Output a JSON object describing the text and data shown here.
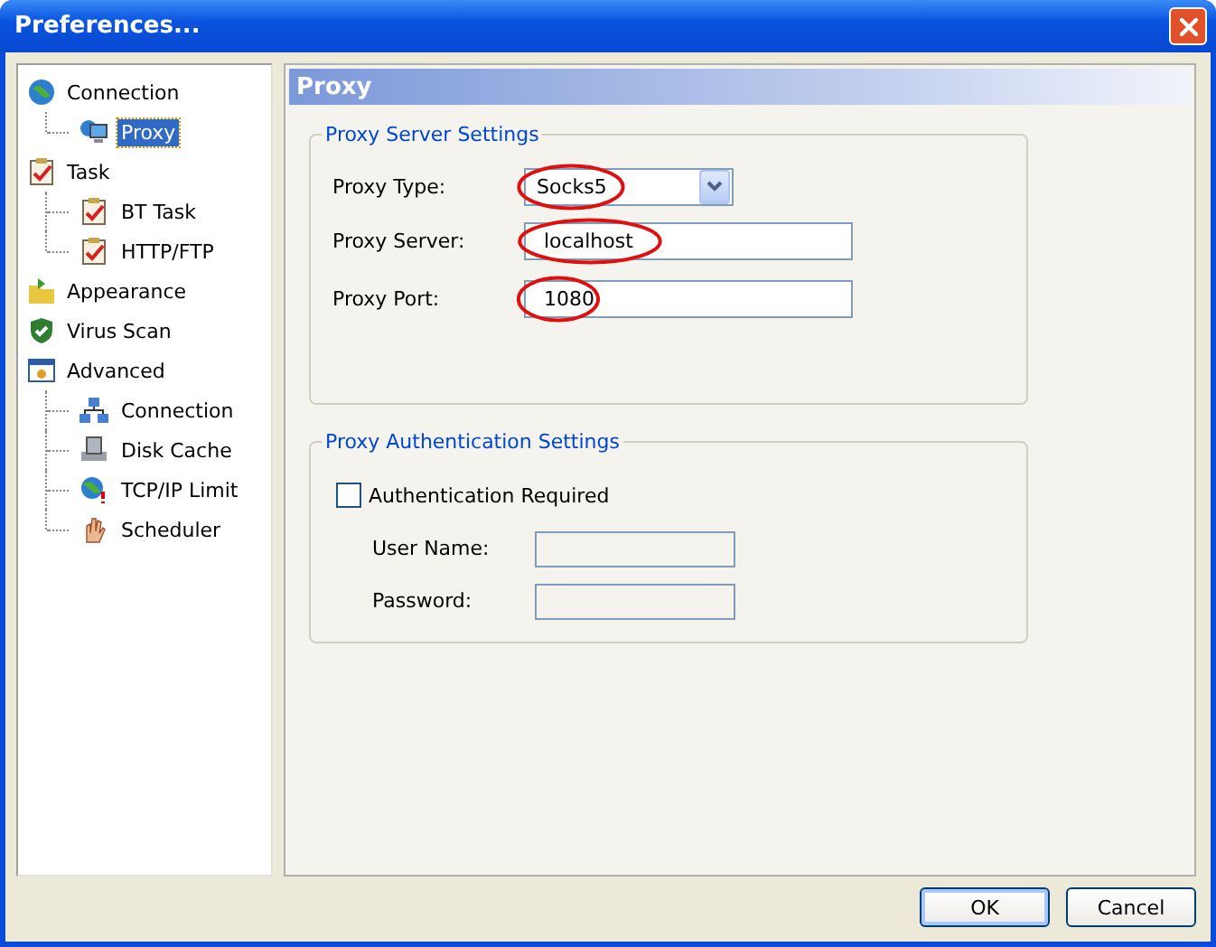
{
  "window": {
    "title": "Preferences..."
  },
  "tree": [
    {
      "label": "Connection",
      "selected": false,
      "children": [
        {
          "label": "Proxy",
          "selected": true
        }
      ]
    },
    {
      "label": "Task",
      "selected": false,
      "children": [
        {
          "label": "BT Task",
          "selected": false
        },
        {
          "label": "HTTP/FTP",
          "selected": false
        }
      ]
    },
    {
      "label": "Appearance",
      "selected": false
    },
    {
      "label": "Virus Scan",
      "selected": false
    },
    {
      "label": "Advanced",
      "selected": false,
      "children": [
        {
          "label": "Connection",
          "selected": false
        },
        {
          "label": "Disk Cache",
          "selected": false
        },
        {
          "label": "TCP/IP Limit",
          "selected": false
        },
        {
          "label": "Scheduler",
          "selected": false
        }
      ]
    }
  ],
  "panel": {
    "title": "Proxy"
  },
  "server_group": {
    "title": "Proxy Server Settings",
    "fields": [
      {
        "label": "Proxy Type:",
        "kind": "dropdown",
        "value": "Socks5",
        "circled": true
      },
      {
        "label": "Proxy Server:",
        "kind": "text",
        "value": "localhost",
        "circled": true
      },
      {
        "label": "Proxy Port:",
        "kind": "text",
        "value": "1080",
        "circled": true
      }
    ]
  },
  "auth_group": {
    "title": "Proxy Authentication Settings",
    "checkbox": {
      "label": "Authentication Required",
      "checked": false
    },
    "fields": [
      {
        "label": "User Name:",
        "kind": "text",
        "disabled": true
      },
      {
        "label": "Password:",
        "kind": "text",
        "disabled": true
      }
    ]
  },
  "buttons": [
    {
      "label": "OK",
      "default": true
    },
    {
      "label": "Cancel",
      "default": false
    }
  ]
}
